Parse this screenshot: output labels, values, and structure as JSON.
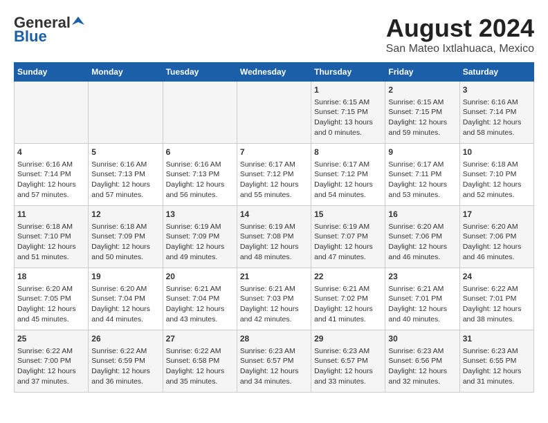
{
  "header": {
    "logo_general": "General",
    "logo_blue": "Blue",
    "main_title": "August 2024",
    "subtitle": "San Mateo Ixtlahuaca, Mexico"
  },
  "days_of_week": [
    "Sunday",
    "Monday",
    "Tuesday",
    "Wednesday",
    "Thursday",
    "Friday",
    "Saturday"
  ],
  "weeks": [
    [
      {
        "day": "",
        "content": ""
      },
      {
        "day": "",
        "content": ""
      },
      {
        "day": "",
        "content": ""
      },
      {
        "day": "",
        "content": ""
      },
      {
        "day": "1",
        "content": "Sunrise: 6:15 AM\nSunset: 7:15 PM\nDaylight: 13 hours\nand 0 minutes."
      },
      {
        "day": "2",
        "content": "Sunrise: 6:15 AM\nSunset: 7:15 PM\nDaylight: 12 hours\nand 59 minutes."
      },
      {
        "day": "3",
        "content": "Sunrise: 6:16 AM\nSunset: 7:14 PM\nDaylight: 12 hours\nand 58 minutes."
      }
    ],
    [
      {
        "day": "4",
        "content": "Sunrise: 6:16 AM\nSunset: 7:14 PM\nDaylight: 12 hours\nand 57 minutes."
      },
      {
        "day": "5",
        "content": "Sunrise: 6:16 AM\nSunset: 7:13 PM\nDaylight: 12 hours\nand 57 minutes."
      },
      {
        "day": "6",
        "content": "Sunrise: 6:16 AM\nSunset: 7:13 PM\nDaylight: 12 hours\nand 56 minutes."
      },
      {
        "day": "7",
        "content": "Sunrise: 6:17 AM\nSunset: 7:12 PM\nDaylight: 12 hours\nand 55 minutes."
      },
      {
        "day": "8",
        "content": "Sunrise: 6:17 AM\nSunset: 7:12 PM\nDaylight: 12 hours\nand 54 minutes."
      },
      {
        "day": "9",
        "content": "Sunrise: 6:17 AM\nSunset: 7:11 PM\nDaylight: 12 hours\nand 53 minutes."
      },
      {
        "day": "10",
        "content": "Sunrise: 6:18 AM\nSunset: 7:10 PM\nDaylight: 12 hours\nand 52 minutes."
      }
    ],
    [
      {
        "day": "11",
        "content": "Sunrise: 6:18 AM\nSunset: 7:10 PM\nDaylight: 12 hours\nand 51 minutes."
      },
      {
        "day": "12",
        "content": "Sunrise: 6:18 AM\nSunset: 7:09 PM\nDaylight: 12 hours\nand 50 minutes."
      },
      {
        "day": "13",
        "content": "Sunrise: 6:19 AM\nSunset: 7:09 PM\nDaylight: 12 hours\nand 49 minutes."
      },
      {
        "day": "14",
        "content": "Sunrise: 6:19 AM\nSunset: 7:08 PM\nDaylight: 12 hours\nand 48 minutes."
      },
      {
        "day": "15",
        "content": "Sunrise: 6:19 AM\nSunset: 7:07 PM\nDaylight: 12 hours\nand 47 minutes."
      },
      {
        "day": "16",
        "content": "Sunrise: 6:20 AM\nSunset: 7:06 PM\nDaylight: 12 hours\nand 46 minutes."
      },
      {
        "day": "17",
        "content": "Sunrise: 6:20 AM\nSunset: 7:06 PM\nDaylight: 12 hours\nand 46 minutes."
      }
    ],
    [
      {
        "day": "18",
        "content": "Sunrise: 6:20 AM\nSunset: 7:05 PM\nDaylight: 12 hours\nand 45 minutes."
      },
      {
        "day": "19",
        "content": "Sunrise: 6:20 AM\nSunset: 7:04 PM\nDaylight: 12 hours\nand 44 minutes."
      },
      {
        "day": "20",
        "content": "Sunrise: 6:21 AM\nSunset: 7:04 PM\nDaylight: 12 hours\nand 43 minutes."
      },
      {
        "day": "21",
        "content": "Sunrise: 6:21 AM\nSunset: 7:03 PM\nDaylight: 12 hours\nand 42 minutes."
      },
      {
        "day": "22",
        "content": "Sunrise: 6:21 AM\nSunset: 7:02 PM\nDaylight: 12 hours\nand 41 minutes."
      },
      {
        "day": "23",
        "content": "Sunrise: 6:21 AM\nSunset: 7:01 PM\nDaylight: 12 hours\nand 40 minutes."
      },
      {
        "day": "24",
        "content": "Sunrise: 6:22 AM\nSunset: 7:01 PM\nDaylight: 12 hours\nand 38 minutes."
      }
    ],
    [
      {
        "day": "25",
        "content": "Sunrise: 6:22 AM\nSunset: 7:00 PM\nDaylight: 12 hours\nand 37 minutes."
      },
      {
        "day": "26",
        "content": "Sunrise: 6:22 AM\nSunset: 6:59 PM\nDaylight: 12 hours\nand 36 minutes."
      },
      {
        "day": "27",
        "content": "Sunrise: 6:22 AM\nSunset: 6:58 PM\nDaylight: 12 hours\nand 35 minutes."
      },
      {
        "day": "28",
        "content": "Sunrise: 6:23 AM\nSunset: 6:57 PM\nDaylight: 12 hours\nand 34 minutes."
      },
      {
        "day": "29",
        "content": "Sunrise: 6:23 AM\nSunset: 6:57 PM\nDaylight: 12 hours\nand 33 minutes."
      },
      {
        "day": "30",
        "content": "Sunrise: 6:23 AM\nSunset: 6:56 PM\nDaylight: 12 hours\nand 32 minutes."
      },
      {
        "day": "31",
        "content": "Sunrise: 6:23 AM\nSunset: 6:55 PM\nDaylight: 12 hours\nand 31 minutes."
      }
    ]
  ]
}
